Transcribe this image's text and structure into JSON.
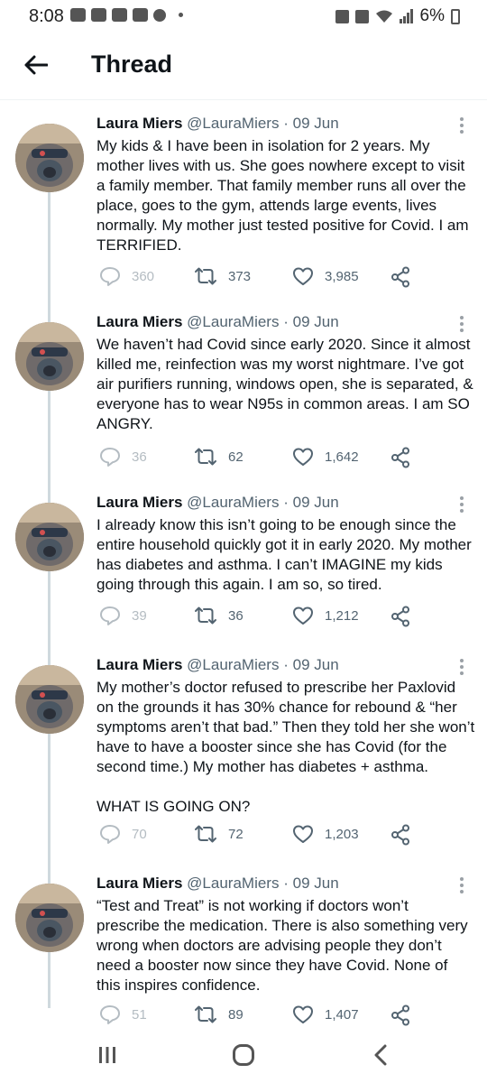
{
  "status_bar": {
    "time": "8:08",
    "battery": "6%"
  },
  "header": {
    "title": "Thread"
  },
  "colors": {
    "text_primary": "#0f1419",
    "text_secondary": "#536471",
    "thread_line": "#cfd9de"
  },
  "tweets": [
    {
      "name": "Laura Miers",
      "handle": "@LauraMiers",
      "sep": "·",
      "date": "09 Jun",
      "paragraphs": [
        "My kids & I have been in isolation for 2 years. My mother lives with us. She goes nowhere except to visit a family member. That family member runs all over the place, goes to the gym, attends large events, lives normally. My mother just tested positive for Covid. I am TERRIFIED."
      ],
      "replies": "360",
      "retweets": "373",
      "likes": "3,985"
    },
    {
      "name": "Laura Miers",
      "handle": "@LauraMiers",
      "sep": "·",
      "date": "09 Jun",
      "paragraphs": [
        "We haven’t had Covid since early 2020. Since it almost killed me, reinfection was my worst nightmare. I’ve got air purifiers running, windows open, she is separated, & everyone has to wear N95s in common areas. I am SO ANGRY."
      ],
      "replies": "36",
      "retweets": "62",
      "likes": "1,642"
    },
    {
      "name": "Laura Miers",
      "handle": "@LauraMiers",
      "sep": "·",
      "date": "09 Jun",
      "paragraphs": [
        "I already know this isn’t going to be enough since the entire household quickly got it in early 2020. My mother has diabetes and asthma. I can’t IMAGINE my kids going through this again. I am so, so tired."
      ],
      "replies": "39",
      "retweets": "36",
      "likes": "1,212"
    },
    {
      "name": "Laura Miers",
      "handle": "@LauraMiers",
      "sep": "·",
      "date": "09 Jun",
      "paragraphs": [
        "My mother’s doctor refused to prescribe her Paxlovid on the grounds it has 30% chance for rebound & “her symptoms aren’t that bad.” Then they told her she won’t have to have a booster since she has Covid (for the second time.) My mother has diabetes + asthma.",
        "WHAT IS GOING ON?"
      ],
      "replies": "70",
      "retweets": "72",
      "likes": "1,203"
    },
    {
      "name": "Laura Miers",
      "handle": "@LauraMiers",
      "sep": "·",
      "date": "09 Jun",
      "paragraphs": [
        "“Test and Treat” is not working if doctors won’t prescribe the medication. There is also something very wrong when doctors are advising people they don’t need a booster now since they have Covid. None of this inspires confidence."
      ],
      "replies": "51",
      "retweets": "89",
      "likes": "1,407"
    }
  ]
}
